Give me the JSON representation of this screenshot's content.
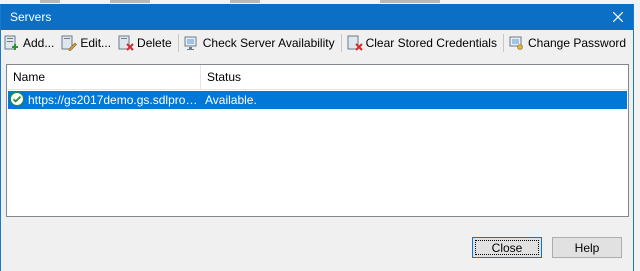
{
  "window": {
    "title": "Servers"
  },
  "toolbar": {
    "add": "Add...",
    "edit": "Edit...",
    "delete": "Delete",
    "check": "Check Server Availability",
    "clear": "Clear Stored Credentials",
    "change_password": "Change Password"
  },
  "list": {
    "columns": [
      "Name",
      "Status"
    ],
    "rows": [
      {
        "name": "https://gs2017demo.gs.sdlproduc...",
        "status": "Available."
      }
    ]
  },
  "buttons": {
    "close": "Close",
    "help": "Help"
  },
  "colors": {
    "title_bar": "#0b6fc6",
    "selection": "#0078d7",
    "button_face": "#e1e1e1"
  }
}
